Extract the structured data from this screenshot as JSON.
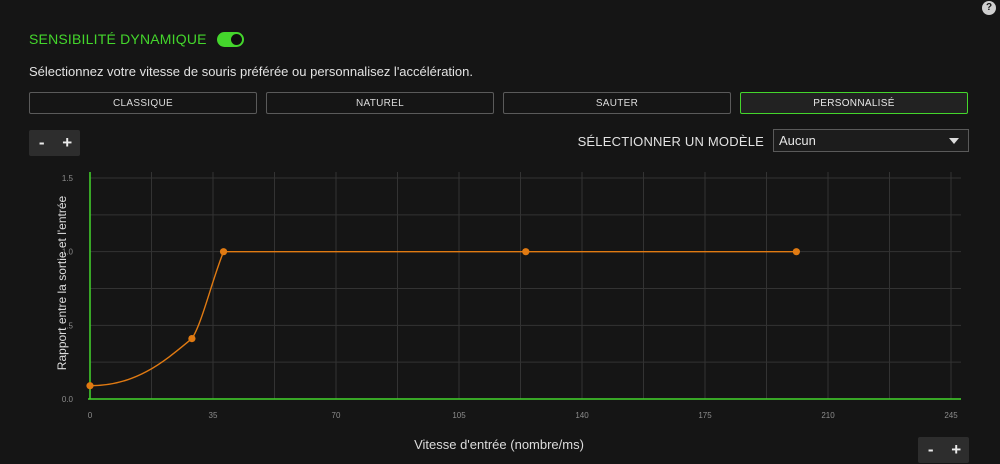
{
  "help": {
    "icon": "question-icon",
    "glyph": "?"
  },
  "header": {
    "title": "SENSIBILITÉ DYNAMIQUE",
    "toggle_on": true
  },
  "subtitle": "Sélectionnez votre vitesse de souris préférée ou personnalisez l'accélération.",
  "presets": [
    {
      "label": "CLASSIQUE",
      "active": false
    },
    {
      "label": "NATUREL",
      "active": false
    },
    {
      "label": "SAUTER",
      "active": false
    },
    {
      "label": "PERSONNALISÉ",
      "active": true
    }
  ],
  "zoom": {
    "minus": "-",
    "plus": "+"
  },
  "template": {
    "label": "SÉLECTIONNER UN MODÈLE",
    "value": "Aucun"
  },
  "colors": {
    "accent": "#44d62c",
    "curve": "#e07a12",
    "grid": "#333333"
  },
  "chart_data": {
    "type": "line",
    "xlabel": "Vitesse d'entrée (nombre/ms)",
    "ylabel": "Rapport entre la sortie et l'entrée",
    "x_ticks": [
      "0",
      "35",
      "70",
      "105",
      "140",
      "175",
      "210",
      "245"
    ],
    "y_ticks": [
      "0.0",
      ".5",
      "1.0",
      "1.5"
    ],
    "xlim": [
      0,
      245
    ],
    "ylim": [
      0,
      1.5
    ],
    "grid": true,
    "series": [
      {
        "points": [
          {
            "x": 0,
            "y": 0.09
          },
          {
            "x": 29,
            "y": 0.41
          },
          {
            "x": 38,
            "y": 1.0
          },
          {
            "x": 124,
            "y": 1.0
          },
          {
            "x": 201,
            "y": 1.0
          }
        ]
      }
    ]
  }
}
